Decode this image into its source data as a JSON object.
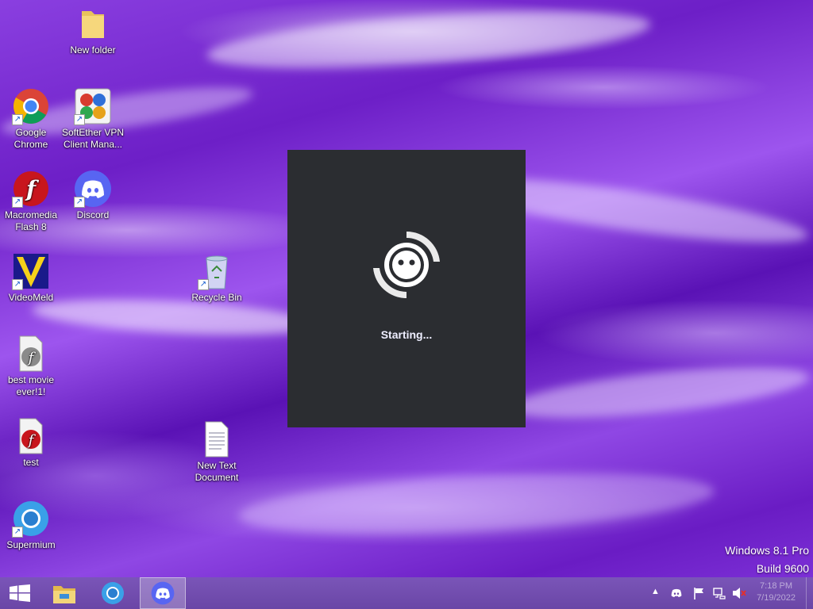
{
  "desktop": {
    "icons": [
      {
        "label": "New folder"
      },
      {
        "label": "Google Chrome"
      },
      {
        "label": "SoftEther VPN Client Mana..."
      },
      {
        "label": "Macromedia Flash 8"
      },
      {
        "label": "Discord"
      },
      {
        "label": "VideoMeld"
      },
      {
        "label": "Recycle Bin"
      },
      {
        "label": "best movie ever!1!"
      },
      {
        "label": "test"
      },
      {
        "label": "New Text Document"
      },
      {
        "label": "Supermium"
      }
    ],
    "watermark": {
      "edition": "Windows 8.1 Pro",
      "build": "Build 9600"
    }
  },
  "splash": {
    "app": "Discord",
    "status": "Starting..."
  },
  "taskbar": {
    "pinned": [
      {
        "icon": "start-icon"
      },
      {
        "icon": "file-explorer-icon"
      },
      {
        "icon": "supermium-icon"
      },
      {
        "icon": "discord-icon",
        "active": true
      }
    ],
    "tray": {
      "icons": [
        "show-hidden-icons-chevron",
        "discord-tray-icon",
        "action-center-flag-icon",
        "network-icon",
        "volume-muted-icon"
      ],
      "time": "7:18 PM",
      "date": "7/19/2022"
    }
  },
  "colors": {
    "splash_bg": "#2b2d31",
    "discord_blurple": "#5865f2",
    "taskbar": "#6a46a6"
  }
}
